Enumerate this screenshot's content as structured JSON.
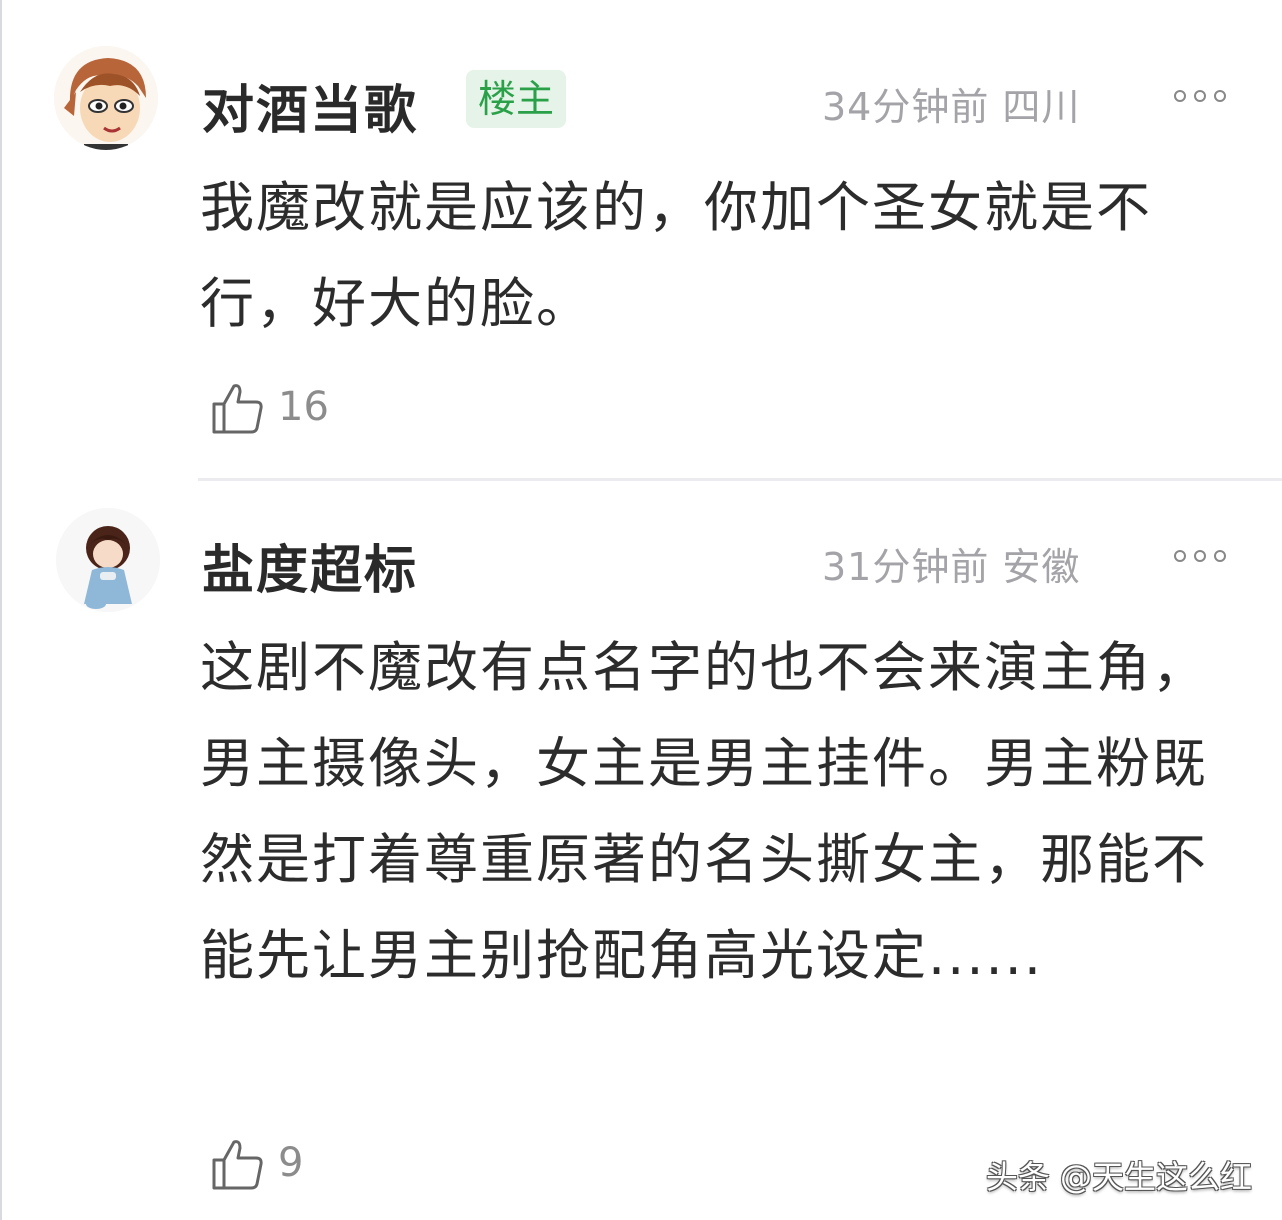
{
  "comments": [
    {
      "username": "对酒当歌",
      "badge": "楼主",
      "meta": "34分钟前 四川",
      "text": "我魔改就是应该的，你加个圣女就是不行，好大的脸。",
      "likes": "16",
      "avatar_icon": "cartoon-boy-avatar-icon"
    },
    {
      "username": "盐度超标",
      "meta": "31分钟前 安徽",
      "text": "这剧不魔改有点名字的也不会来演主角，男主摄像头，女主是男主挂件。男主粉既然是打着尊重原著的名头撕女主，那能不能先让男主别抢配角高光设定......",
      "likes": "9",
      "avatar_icon": "cartoon-child-avatar-icon"
    }
  ],
  "watermark": "头条 @天生这么红",
  "colors": {
    "badge_bg": "#e5f3e8",
    "badge_text": "#2aa149",
    "meta_text": "#a3a3a8",
    "body_text": "#2c2c2c"
  }
}
